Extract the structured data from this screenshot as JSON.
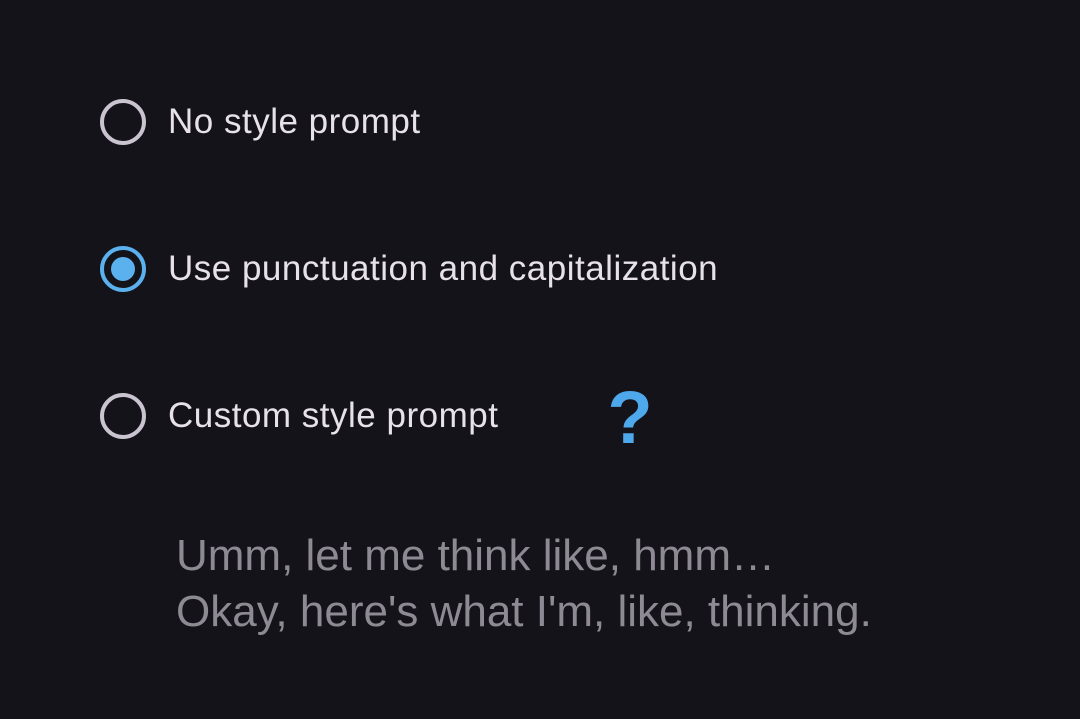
{
  "style_options": {
    "items": [
      {
        "label": "No style prompt",
        "selected": false
      },
      {
        "label": "Use punctuation and capitalization",
        "selected": true
      },
      {
        "label": "Custom style prompt",
        "selected": false
      }
    ],
    "help_icon": "question-mark-icon"
  },
  "custom_prompt": {
    "placeholder_lines": [
      "Umm, let me think like, hmm…",
      "Okay, here's what I'm, like, thinking."
    ]
  },
  "colors": {
    "background": "#15131a",
    "accent": "#5bb0ee",
    "text": "#e7e1ea",
    "placeholder": "#8e8a94"
  }
}
